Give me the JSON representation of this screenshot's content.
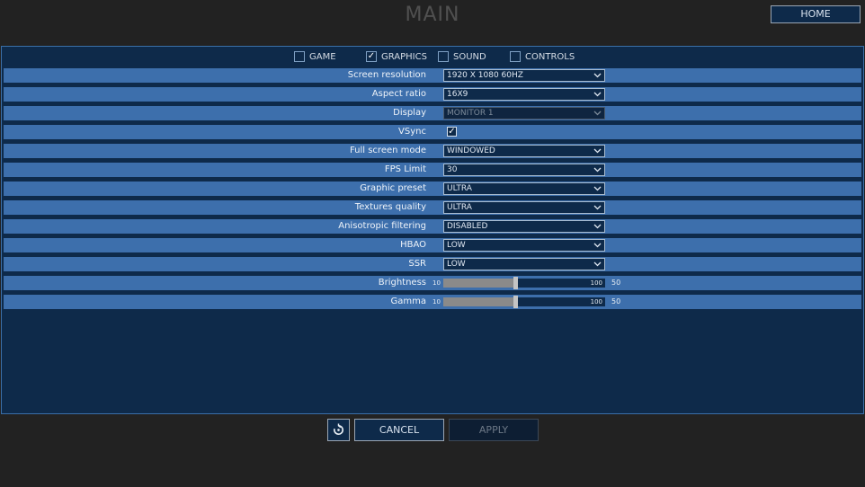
{
  "header": {
    "title": "MAIN",
    "home_label": "HOME"
  },
  "tabs": [
    {
      "label": "GAME",
      "checked": false
    },
    {
      "label": "GRAPHICS",
      "checked": true
    },
    {
      "label": "SOUND",
      "checked": false
    },
    {
      "label": "CONTROLS",
      "checked": false
    }
  ],
  "settings": {
    "screen_resolution": {
      "label": "Screen resolution",
      "value": "1920 X 1080 60HZ"
    },
    "aspect_ratio": {
      "label": "Aspect ratio",
      "value": "16X9"
    },
    "display": {
      "label": "Display",
      "value": "MONITOR 1",
      "disabled": true
    },
    "vsync": {
      "label": "VSync",
      "checked": true
    },
    "full_screen_mode": {
      "label": "Full screen mode",
      "value": "WINDOWED"
    },
    "fps_limit": {
      "label": "FPS Limit",
      "value": "30"
    },
    "graphic_preset": {
      "label": "Graphic preset",
      "value": "ULTRA"
    },
    "textures_quality": {
      "label": "Textures quality",
      "value": "ULTRA"
    },
    "anisotropic_filtering": {
      "label": "Anisotropic filtering",
      "value": "DISABLED"
    },
    "hbao": {
      "label": "HBAO",
      "value": "LOW"
    },
    "ssr": {
      "label": "SSR",
      "value": "LOW"
    },
    "brightness": {
      "label": "Brightness",
      "min": "10",
      "max": "100",
      "value": "50"
    },
    "gamma": {
      "label": "Gamma",
      "min": "10",
      "max": "100",
      "value": "50"
    }
  },
  "footer": {
    "cancel_label": "CANCEL",
    "apply_label": "APPLY"
  },
  "icons": {
    "reset": "reset-icon",
    "checkmark": "checkmark-icon",
    "dropdown": "chevron-down-icon"
  },
  "colors": {
    "background": "#222222",
    "panel": "#0e2a4a",
    "row": "#3d6fac",
    "border": "#3a6fa8"
  }
}
